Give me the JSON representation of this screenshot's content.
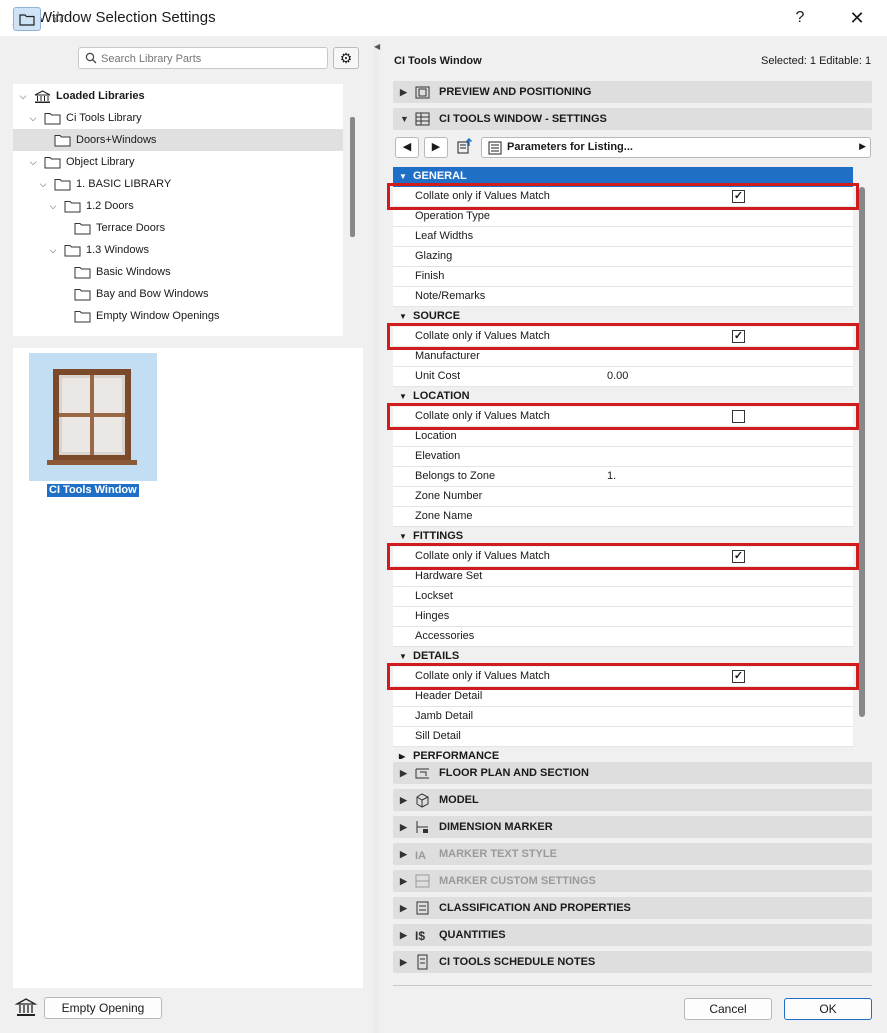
{
  "window": {
    "title": "Window Selection Settings",
    "help": "?",
    "close": "✕"
  },
  "search": {
    "placeholder": "Search Library Parts"
  },
  "tree": [
    {
      "label": "Loaded Libraries",
      "bold": true
    },
    {
      "label": "Ci Tools Library"
    },
    {
      "label": "Doors+Windows",
      "selected": true
    },
    {
      "label": "Object Library"
    },
    {
      "label": "1. BASIC LIBRARY"
    },
    {
      "label": "1.2 Doors"
    },
    {
      "label": "Terrace Doors"
    },
    {
      "label": "1.3 Windows"
    },
    {
      "label": "Basic Windows"
    },
    {
      "label": "Bay and Bow Windows"
    },
    {
      "label": "Empty Window Openings"
    }
  ],
  "preview": {
    "item_label": "CI Tools Window"
  },
  "left_footer": {
    "empty_opening": "Empty Opening"
  },
  "right": {
    "title": "CI Tools Window",
    "selected": "Selected: 1 Editable: 1",
    "top_sections": [
      {
        "label": "PREVIEW AND POSITIONING",
        "icon": "preview-icon",
        "expanded": false
      },
      {
        "label": "CI TOOLS WINDOW - SETTINGS",
        "icon": "settings-grid-icon",
        "expanded": true
      }
    ],
    "param_dropdown": "Parameters for Listing...",
    "groups": [
      {
        "name": "GENERAL",
        "active": true,
        "rows": [
          {
            "label": "Collate only if Values Match",
            "checkbox": true,
            "checked": true
          },
          {
            "label": "Operation Type"
          },
          {
            "label": "Leaf Widths"
          },
          {
            "label": "Glazing"
          },
          {
            "label": "Finish"
          },
          {
            "label": "Note/Remarks"
          }
        ]
      },
      {
        "name": "SOURCE",
        "rows": [
          {
            "label": "Collate only if Values Match",
            "checkbox": true,
            "checked": true
          },
          {
            "label": "Manufacturer"
          },
          {
            "label": "Unit Cost",
            "value": "0.00"
          }
        ]
      },
      {
        "name": "LOCATION",
        "rows": [
          {
            "label": "Collate only if Values Match",
            "checkbox": true,
            "checked": false
          },
          {
            "label": "Location"
          },
          {
            "label": "Elevation"
          },
          {
            "label": "Belongs to Zone",
            "value": "1."
          },
          {
            "label": "Zone Number"
          },
          {
            "label": "Zone Name"
          }
        ]
      },
      {
        "name": "FITTINGS",
        "rows": [
          {
            "label": "Collate only if Values Match",
            "checkbox": true,
            "checked": true
          },
          {
            "label": "Hardware Set"
          },
          {
            "label": "Lockset"
          },
          {
            "label": "Hinges"
          },
          {
            "label": "Accessories"
          }
        ]
      },
      {
        "name": "DETAILS",
        "rows": [
          {
            "label": "Collate only if Values Match",
            "checkbox": true,
            "checked": true
          },
          {
            "label": "Header Detail"
          },
          {
            "label": "Jamb Detail"
          },
          {
            "label": "Sill Detail"
          }
        ]
      },
      {
        "name": "PERFORMANCE",
        "collapsed": true,
        "rows": []
      }
    ],
    "bottom_sections": [
      {
        "label": "FLOOR PLAN AND SECTION",
        "icon": "floor-plan-icon",
        "disabled": false
      },
      {
        "label": "MODEL",
        "icon": "model-cube-icon",
        "disabled": false
      },
      {
        "label": "DIMENSION MARKER",
        "icon": "dimension-marker-icon",
        "disabled": false
      },
      {
        "label": "MARKER TEXT STYLE",
        "icon": "text-style-icon",
        "disabled": true
      },
      {
        "label": "MARKER CUSTOM SETTINGS",
        "icon": "custom-settings-icon",
        "disabled": true
      },
      {
        "label": "CLASSIFICATION AND PROPERTIES",
        "icon": "classification-icon",
        "disabled": false
      },
      {
        "label": "QUANTITIES",
        "icon": "quantities-icon",
        "disabled": false
      },
      {
        "label": "CI TOOLS SCHEDULE NOTES",
        "icon": "schedule-notes-icon",
        "disabled": false
      }
    ]
  },
  "buttons": {
    "cancel": "Cancel",
    "ok": "OK"
  },
  "colors": {
    "accent": "#1f6fc7",
    "highlight": "#d01c1c",
    "section_bar": "#dedede"
  }
}
